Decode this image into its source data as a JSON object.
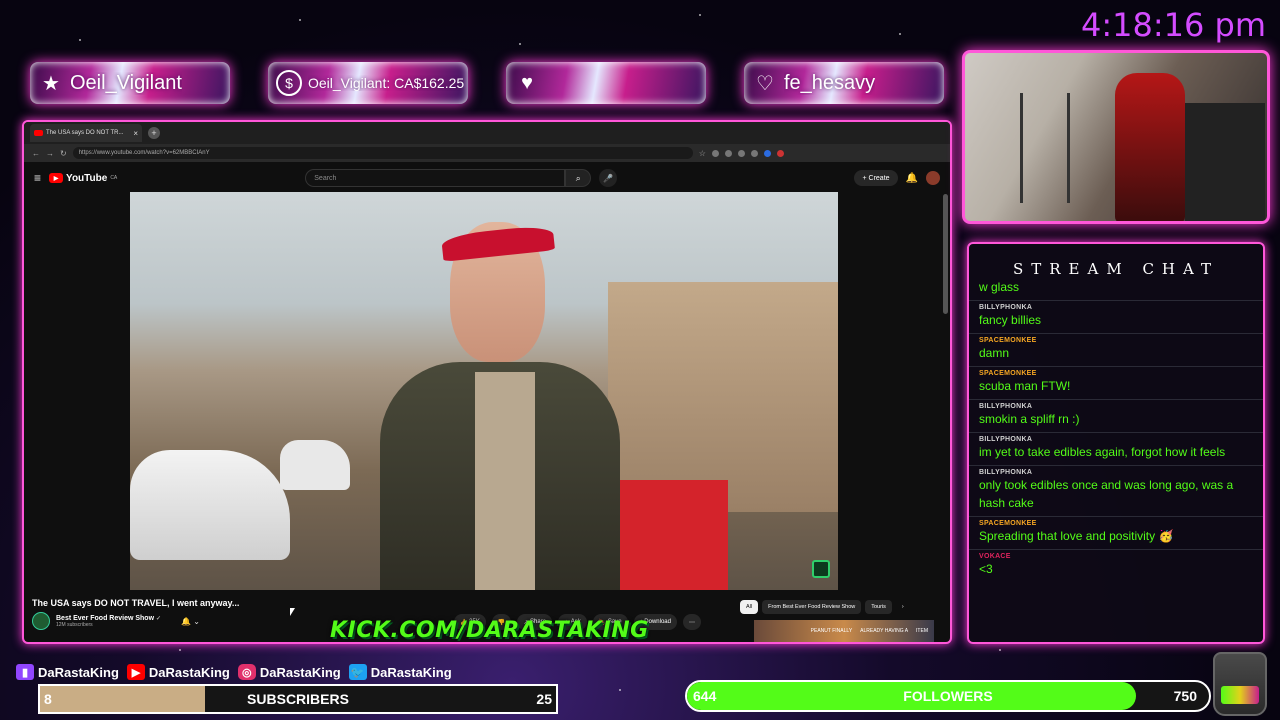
{
  "clock": "4:18:16 pm",
  "alerts": [
    {
      "icon": "★",
      "icon_name": "star-icon",
      "text": "Oeil_Vigilant"
    },
    {
      "icon": "$",
      "icon_name": "dollar-icon",
      "text": "Oeil_Vigilant: CA$162.25"
    },
    {
      "icon": "♥",
      "icon_name": "heart-icon",
      "text": ""
    },
    {
      "icon": "♡",
      "icon_name": "heart-outline-icon",
      "text": "fe_hesavy"
    }
  ],
  "browser": {
    "tab_title": "The USA says DO NOT TR...",
    "tab_close": "×",
    "new_tab": "+",
    "url": "https://www.youtube.com/watch?v=62MBBCIAnY"
  },
  "youtube": {
    "logo_text": "YouTube",
    "logo_region": "CA",
    "search_placeholder": "Search",
    "create_label": "Create",
    "video_title": "The USA says DO NOT TRAVEL, I went anyway...",
    "channel_name": "Best Ever Food Review Show",
    "channel_verified": "✓",
    "subscribers": "12M subscribers",
    "actions": [
      {
        "label": "25K",
        "icon": "👍"
      },
      {
        "label": "",
        "icon": "👎"
      },
      {
        "label": "Share",
        "icon": "↗"
      },
      {
        "label": "Ask",
        "icon": "✦"
      },
      {
        "label": "Save",
        "icon": "🔖"
      },
      {
        "label": "Download",
        "icon": "↓"
      },
      {
        "label": "",
        "icon": "⋯"
      }
    ],
    "chips": [
      "All",
      "From Best Ever Food Review Show",
      "Touris"
    ],
    "chip_next": "›",
    "thumb_text_1": "PEANUT FINALLY",
    "thumb_text_2": "ALREADY HAVING A",
    "thumb_text_3": "ITEM"
  },
  "overlay_url": "KICK.COM/DARASTAKING",
  "chat": {
    "title": "STREAM CHAT",
    "messages": [
      {
        "user": "",
        "user_color": "#53fc18",
        "text": "w glass"
      },
      {
        "user": "BILLYPHONKA",
        "user_color": "#d0d0d0",
        "text": "fancy billies"
      },
      {
        "user": "SPACEMONKEE",
        "user_color": "#f5a623",
        "text": "damn"
      },
      {
        "user": "SPACEMONKEE",
        "user_color": "#f5a623",
        "text": "scuba man FTW!"
      },
      {
        "user": "BILLYPHONKA",
        "user_color": "#d0d0d0",
        "text": "smokin a spliff rn :)"
      },
      {
        "user": "BILLYPHONKA",
        "user_color": "#d0d0d0",
        "text": "im yet to take edibles again, forgot how it feels"
      },
      {
        "user": "BILLYPHONKA",
        "user_color": "#d0d0d0",
        "text": "only took edibles once and was long ago, was a hash cake"
      },
      {
        "user": "SPACEMONKEE",
        "user_color": "#f5a623",
        "text": "Spreading that love and positivity 🥳"
      },
      {
        "user": "VOKACE",
        "user_color": "#e0245e",
        "text": "<3"
      }
    ]
  },
  "socials": [
    {
      "icon_name": "twitch-icon",
      "icon": "▮",
      "color": "#9146ff",
      "label": "DaRastaKing"
    },
    {
      "icon_name": "youtube-icon",
      "icon": "▶",
      "color": "#ff0000",
      "label": "DaRastaKing"
    },
    {
      "icon_name": "instagram-icon",
      "icon": "◎",
      "color": "#e1306c",
      "label": "DaRastaKing"
    },
    {
      "icon_name": "twitter-icon",
      "icon": "🐦",
      "color": "#1da1f2",
      "label": "DaRastaKing"
    }
  ],
  "subscribers_goal": {
    "current": "8",
    "label": "SUBSCRIBERS",
    "goal": "25",
    "progress": 0.32
  },
  "followers_goal": {
    "current": "644",
    "label": "FOLLOWERS",
    "goal": "750",
    "progress": 0.86
  }
}
